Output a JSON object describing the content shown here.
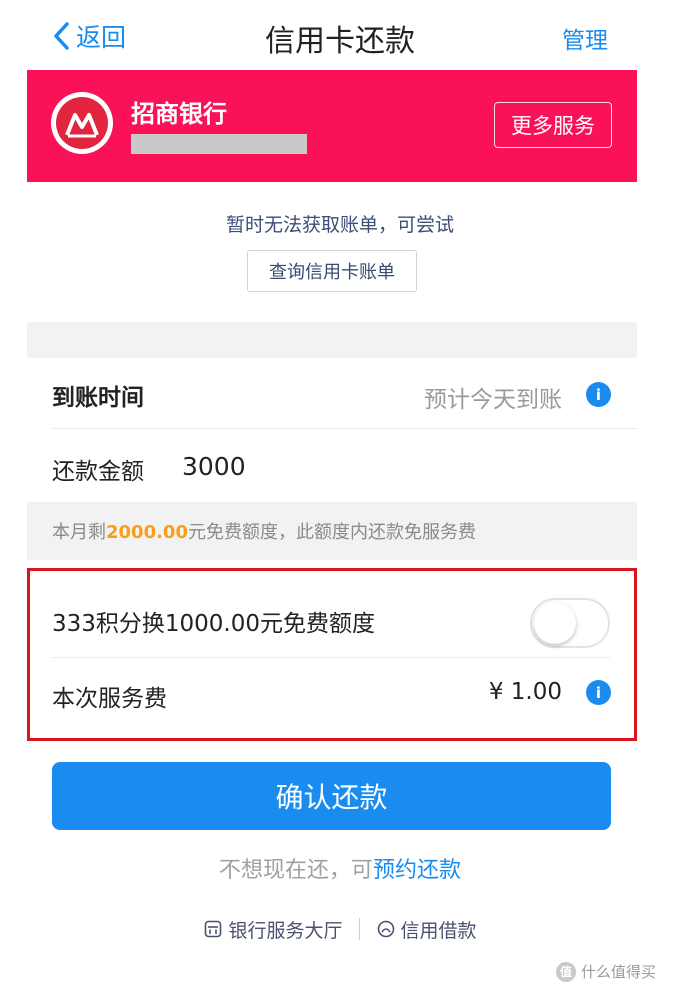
{
  "nav": {
    "back_label": "返回",
    "title": "信用卡还款",
    "manage_label": "管理"
  },
  "bank": {
    "name": "招商银行",
    "more_services_label": "更多服务",
    "brand_color": "#fa1158"
  },
  "bill": {
    "hint": "暂时无法获取账单，可尝试",
    "query_button_label": "查询信用卡账单"
  },
  "arrival": {
    "label": "到账时间",
    "value": "预计今天到账"
  },
  "amount": {
    "label": "还款金额",
    "value": "3000"
  },
  "quota": {
    "prefix": "本月剩",
    "amount": "2000.00",
    "suffix": "元免费额度，此额度内还款免服务费"
  },
  "points": {
    "label": "333积分换1000.00元免费额度",
    "toggle_on": false
  },
  "fee": {
    "label": "本次服务费",
    "value": "¥ 1.00"
  },
  "confirm_label": "确认还款",
  "reserve": {
    "text": "不想现在还，可",
    "link": "预约还款"
  },
  "links": {
    "bank_hall": "银行服务大厅",
    "credit_loan": "信用借款"
  },
  "watermark": "什么值得买",
  "colors": {
    "accent": "#1a8cf0",
    "highlight": "#f5a01a",
    "alert_border": "#d9141f"
  }
}
